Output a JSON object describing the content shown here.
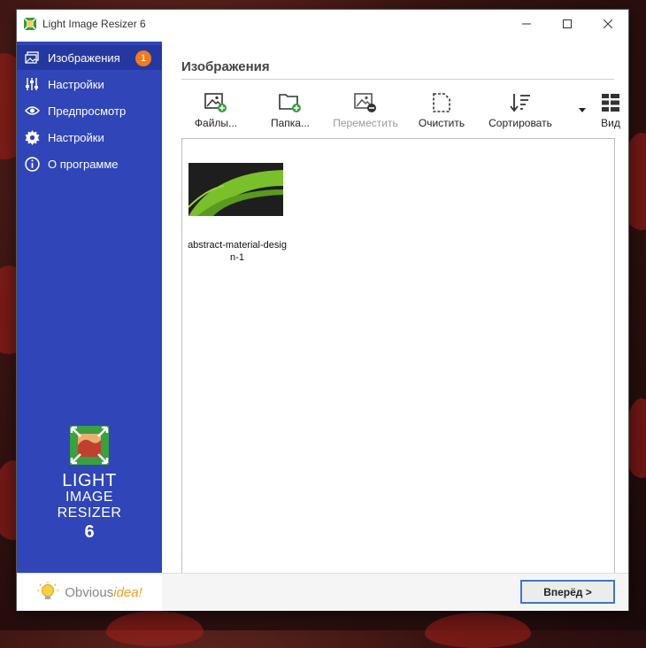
{
  "window": {
    "title": "Light Image Resizer 6"
  },
  "sidebar": {
    "items": [
      {
        "label": "Изображения",
        "icon": "images-icon",
        "active": true,
        "badge": "1"
      },
      {
        "label": "Настройки",
        "icon": "sliders-icon"
      },
      {
        "label": "Предпросмотр",
        "icon": "eye-icon"
      },
      {
        "label": "Настройки",
        "icon": "gear-icon"
      },
      {
        "label": "О программе",
        "icon": "info-icon"
      }
    ],
    "brand": {
      "line1": "LIGHT",
      "line2": "IMAGE",
      "line3": "RESIZER",
      "line4": "6"
    },
    "footer": {
      "brand_part1": "Obvious",
      "brand_part2": "idea!"
    }
  },
  "main": {
    "title": "Изображения",
    "toolbar": {
      "files": "Файлы...",
      "folder": "Папка...",
      "move": "Переместить",
      "clear": "Очистить",
      "sort": "Сортировать",
      "view": "Вид"
    },
    "images": [
      {
        "name": "abstract-material-design-1"
      }
    ],
    "next_button": "Вперёд >"
  },
  "colors": {
    "sidebar": "#2f45b8",
    "badge": "#f07a1e",
    "accent": "#3a78c8",
    "thumb_green": "#7ac02a"
  }
}
